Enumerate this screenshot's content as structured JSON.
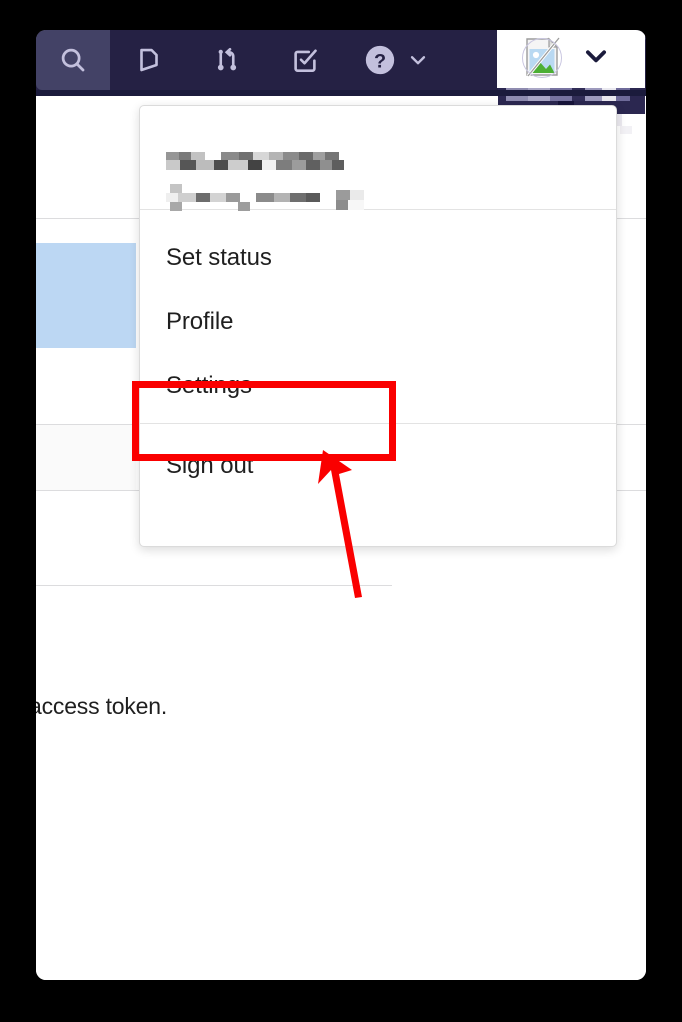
{
  "window": {
    "name": "gitlab-browser-window"
  },
  "navbar": {
    "background": "#252144",
    "active_background": "#434266",
    "icon_color": "#c3c0dd",
    "items": [
      {
        "name": "search-icon",
        "label": "Search",
        "active": true
      },
      {
        "name": "issues-icon",
        "label": "Issues",
        "active": false
      },
      {
        "name": "merge-requests-icon",
        "label": "Merge requests",
        "active": false
      },
      {
        "name": "todos-icon",
        "label": "To-Do List",
        "active": false
      },
      {
        "name": "help-icon",
        "label": "Help",
        "active": false
      }
    ],
    "help_chevron": "chevron-down-icon",
    "user_chevron": "chevron-down-icon",
    "avatar": {
      "name": "broken-image-icon",
      "state": "broken",
      "alt": ""
    },
    "tooltip_redacted": true
  },
  "dropdown": {
    "name": "user-menu",
    "user": {
      "display_name_redacted": true,
      "username_redacted": true
    },
    "items": [
      {
        "label": "Set status",
        "name": "menu-item-set-status"
      },
      {
        "label": "Profile",
        "name": "menu-item-profile"
      },
      {
        "label": "Settings",
        "name": "menu-item-settings",
        "highlighted": true
      },
      {
        "label": "Sign out",
        "name": "menu-item-sign-out"
      }
    ]
  },
  "page": {
    "cut_text": "access token.",
    "selected_row_color": "#bcd7f3",
    "striped_row_color": "#fafafa"
  },
  "annotation": {
    "highlight_color": "#fa0000",
    "arrow_color": "#fa0000",
    "target": "Settings"
  }
}
